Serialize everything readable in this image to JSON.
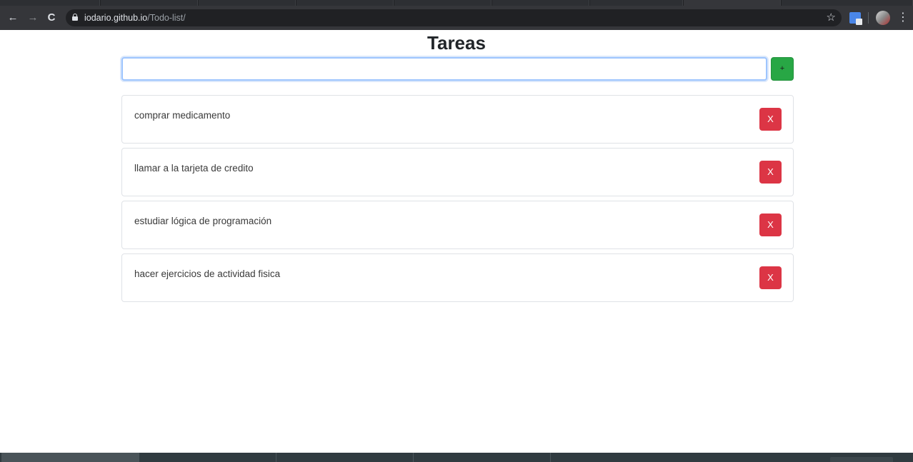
{
  "browser": {
    "url_host": "iodario.github.io",
    "url_path": "/Todo-list/",
    "icons": {
      "back": "arrow-left-icon",
      "forward": "arrow-right-icon",
      "reload": "reload-icon",
      "lock": "lock-icon",
      "bookmark": "star-icon",
      "menu": "vertical-dots-icon"
    },
    "glyphs": {
      "back": "←",
      "forward": "→",
      "reload": "C",
      "star": "☆",
      "menu": "⋮"
    }
  },
  "app": {
    "title": "Tareas",
    "input": {
      "value": "",
      "placeholder": ""
    },
    "add_label": "+",
    "colors": {
      "add": "#28a745",
      "delete": "#dc3545",
      "focus": "#9ec5fe"
    },
    "tasks": [
      {
        "text": "comprar medicamento",
        "delete_label": "X"
      },
      {
        "text": "llamar a la tarjeta de credito",
        "delete_label": "X"
      },
      {
        "text": "estudiar lógica de programación",
        "delete_label": "X"
      },
      {
        "text": "hacer ejercicios de actividad fisica",
        "delete_label": "X"
      }
    ]
  }
}
